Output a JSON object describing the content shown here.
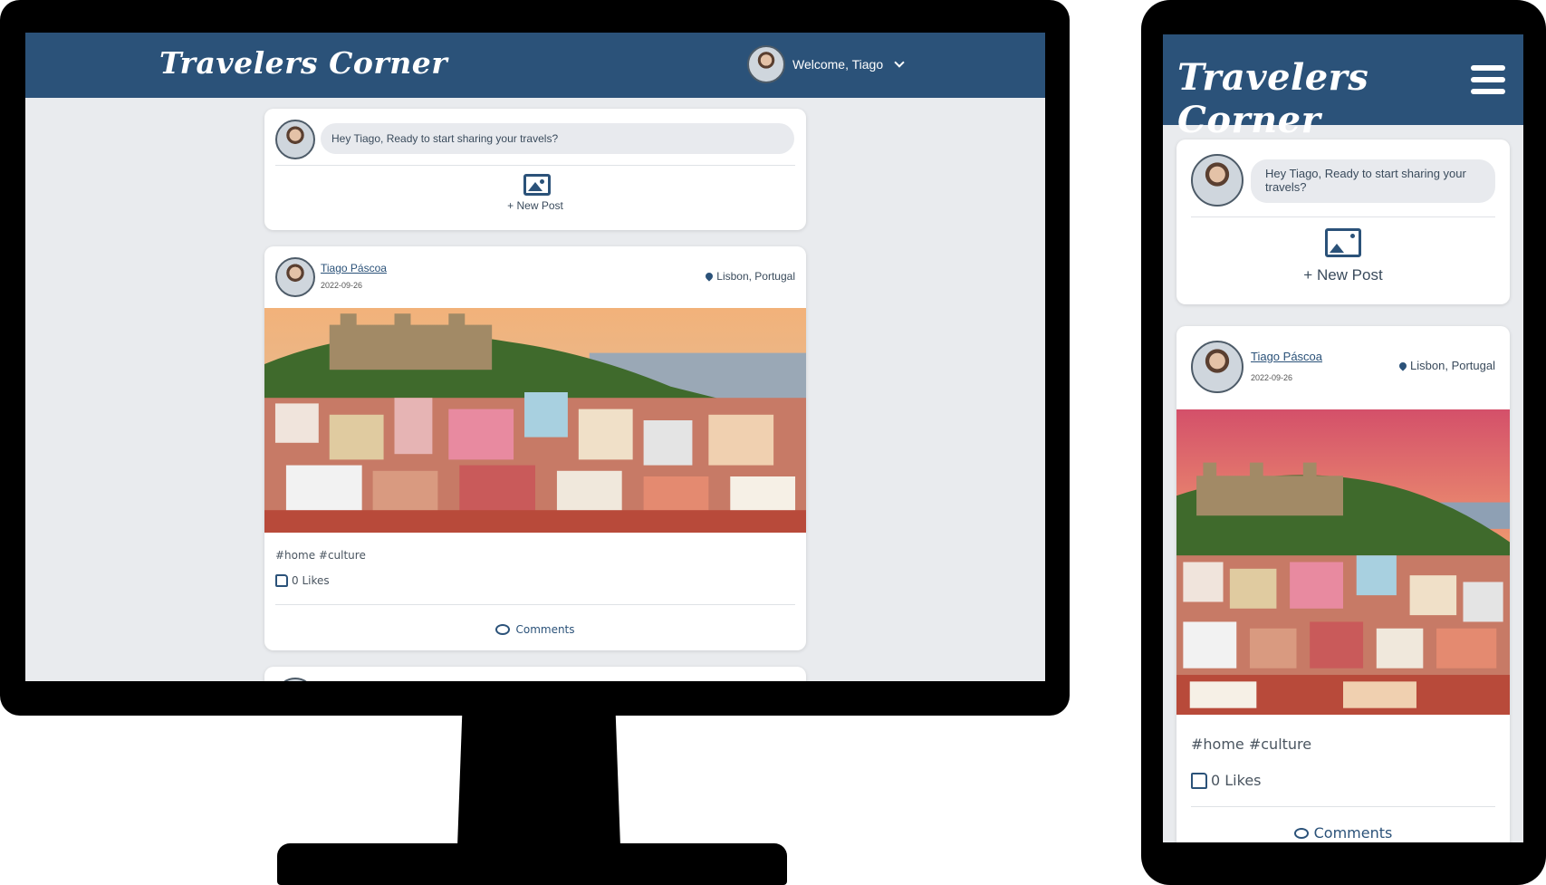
{
  "app": {
    "brand": "Travelers Corner"
  },
  "header": {
    "welcome": "Welcome, Tiago"
  },
  "compose": {
    "prompt": "Hey Tiago, Ready to start sharing your travels?",
    "new_post_label": "+ New Post"
  },
  "post": {
    "author": "Tiago Páscoa",
    "date": "2022-09-26",
    "location": "Lisbon, Portugal",
    "tags": "#home  #culture",
    "likes": "0 Likes",
    "comments_label": "Comments"
  },
  "colors": {
    "accent": "#2b5279",
    "background": "#e9ebee",
    "card": "#ffffff"
  },
  "icons": [
    "avatar",
    "chevron-down-icon",
    "image-icon",
    "location-pin-icon",
    "thumbs-up-icon",
    "comments-icon",
    "hamburger-menu-icon"
  ]
}
